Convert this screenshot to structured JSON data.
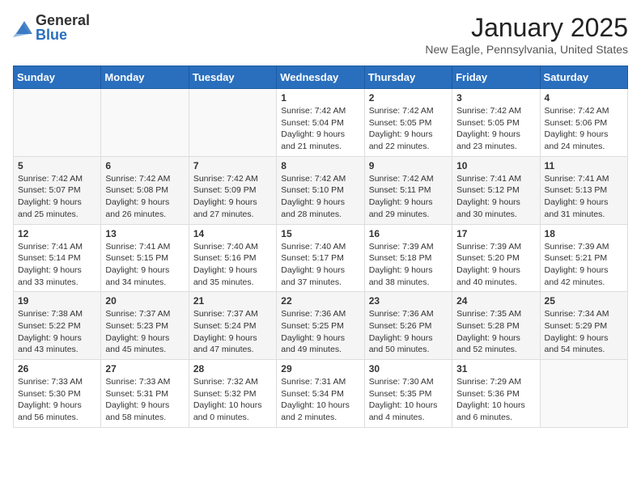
{
  "header": {
    "logo_general": "General",
    "logo_blue": "Blue",
    "month": "January 2025",
    "location": "New Eagle, Pennsylvania, United States"
  },
  "weekdays": [
    "Sunday",
    "Monday",
    "Tuesday",
    "Wednesday",
    "Thursday",
    "Friday",
    "Saturday"
  ],
  "weeks": [
    [
      {
        "day": "",
        "info": ""
      },
      {
        "day": "",
        "info": ""
      },
      {
        "day": "",
        "info": ""
      },
      {
        "day": "1",
        "info": "Sunrise: 7:42 AM\nSunset: 5:04 PM\nDaylight: 9 hours and 21 minutes."
      },
      {
        "day": "2",
        "info": "Sunrise: 7:42 AM\nSunset: 5:05 PM\nDaylight: 9 hours and 22 minutes."
      },
      {
        "day": "3",
        "info": "Sunrise: 7:42 AM\nSunset: 5:05 PM\nDaylight: 9 hours and 23 minutes."
      },
      {
        "day": "4",
        "info": "Sunrise: 7:42 AM\nSunset: 5:06 PM\nDaylight: 9 hours and 24 minutes."
      }
    ],
    [
      {
        "day": "5",
        "info": "Sunrise: 7:42 AM\nSunset: 5:07 PM\nDaylight: 9 hours and 25 minutes."
      },
      {
        "day": "6",
        "info": "Sunrise: 7:42 AM\nSunset: 5:08 PM\nDaylight: 9 hours and 26 minutes."
      },
      {
        "day": "7",
        "info": "Sunrise: 7:42 AM\nSunset: 5:09 PM\nDaylight: 9 hours and 27 minutes."
      },
      {
        "day": "8",
        "info": "Sunrise: 7:42 AM\nSunset: 5:10 PM\nDaylight: 9 hours and 28 minutes."
      },
      {
        "day": "9",
        "info": "Sunrise: 7:42 AM\nSunset: 5:11 PM\nDaylight: 9 hours and 29 minutes."
      },
      {
        "day": "10",
        "info": "Sunrise: 7:41 AM\nSunset: 5:12 PM\nDaylight: 9 hours and 30 minutes."
      },
      {
        "day": "11",
        "info": "Sunrise: 7:41 AM\nSunset: 5:13 PM\nDaylight: 9 hours and 31 minutes."
      }
    ],
    [
      {
        "day": "12",
        "info": "Sunrise: 7:41 AM\nSunset: 5:14 PM\nDaylight: 9 hours and 33 minutes."
      },
      {
        "day": "13",
        "info": "Sunrise: 7:41 AM\nSunset: 5:15 PM\nDaylight: 9 hours and 34 minutes."
      },
      {
        "day": "14",
        "info": "Sunrise: 7:40 AM\nSunset: 5:16 PM\nDaylight: 9 hours and 35 minutes."
      },
      {
        "day": "15",
        "info": "Sunrise: 7:40 AM\nSunset: 5:17 PM\nDaylight: 9 hours and 37 minutes."
      },
      {
        "day": "16",
        "info": "Sunrise: 7:39 AM\nSunset: 5:18 PM\nDaylight: 9 hours and 38 minutes."
      },
      {
        "day": "17",
        "info": "Sunrise: 7:39 AM\nSunset: 5:20 PM\nDaylight: 9 hours and 40 minutes."
      },
      {
        "day": "18",
        "info": "Sunrise: 7:39 AM\nSunset: 5:21 PM\nDaylight: 9 hours and 42 minutes."
      }
    ],
    [
      {
        "day": "19",
        "info": "Sunrise: 7:38 AM\nSunset: 5:22 PM\nDaylight: 9 hours and 43 minutes."
      },
      {
        "day": "20",
        "info": "Sunrise: 7:37 AM\nSunset: 5:23 PM\nDaylight: 9 hours and 45 minutes."
      },
      {
        "day": "21",
        "info": "Sunrise: 7:37 AM\nSunset: 5:24 PM\nDaylight: 9 hours and 47 minutes."
      },
      {
        "day": "22",
        "info": "Sunrise: 7:36 AM\nSunset: 5:25 PM\nDaylight: 9 hours and 49 minutes."
      },
      {
        "day": "23",
        "info": "Sunrise: 7:36 AM\nSunset: 5:26 PM\nDaylight: 9 hours and 50 minutes."
      },
      {
        "day": "24",
        "info": "Sunrise: 7:35 AM\nSunset: 5:28 PM\nDaylight: 9 hours and 52 minutes."
      },
      {
        "day": "25",
        "info": "Sunrise: 7:34 AM\nSunset: 5:29 PM\nDaylight: 9 hours and 54 minutes."
      }
    ],
    [
      {
        "day": "26",
        "info": "Sunrise: 7:33 AM\nSunset: 5:30 PM\nDaylight: 9 hours and 56 minutes."
      },
      {
        "day": "27",
        "info": "Sunrise: 7:33 AM\nSunset: 5:31 PM\nDaylight: 9 hours and 58 minutes."
      },
      {
        "day": "28",
        "info": "Sunrise: 7:32 AM\nSunset: 5:32 PM\nDaylight: 10 hours and 0 minutes."
      },
      {
        "day": "29",
        "info": "Sunrise: 7:31 AM\nSunset: 5:34 PM\nDaylight: 10 hours and 2 minutes."
      },
      {
        "day": "30",
        "info": "Sunrise: 7:30 AM\nSunset: 5:35 PM\nDaylight: 10 hours and 4 minutes."
      },
      {
        "day": "31",
        "info": "Sunrise: 7:29 AM\nSunset: 5:36 PM\nDaylight: 10 hours and 6 minutes."
      },
      {
        "day": "",
        "info": ""
      }
    ]
  ]
}
